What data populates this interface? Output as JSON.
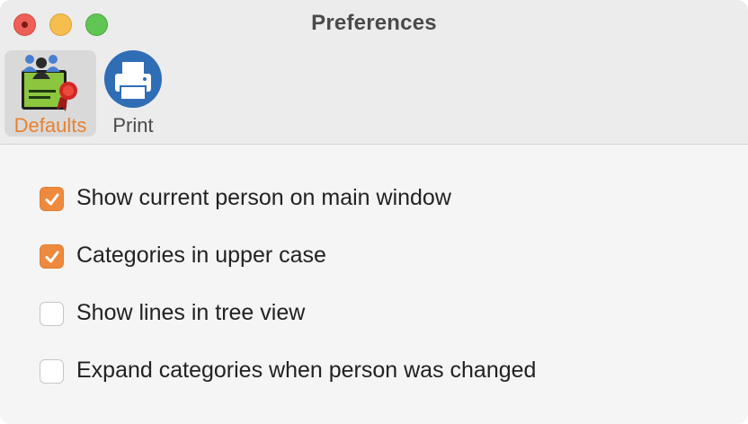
{
  "window": {
    "title": "Preferences"
  },
  "toolbar": {
    "items": [
      {
        "label": "Defaults",
        "icon": "defaults-certificate-icon",
        "selected": true
      },
      {
        "label": "Print",
        "icon": "printer-icon",
        "selected": false
      }
    ]
  },
  "options": [
    {
      "label": "Show current person on main window",
      "checked": true
    },
    {
      "label": "Categories in upper case",
      "checked": true
    },
    {
      "label": "Show lines in tree view",
      "checked": false
    },
    {
      "label": "Expand categories when person was changed",
      "checked": false
    }
  ],
  "colors": {
    "accent": "#ee8a3d",
    "close": "#ee5f57",
    "minimize": "#f6be4f",
    "zoom": "#61c554",
    "print_icon": "#2f6db5"
  }
}
